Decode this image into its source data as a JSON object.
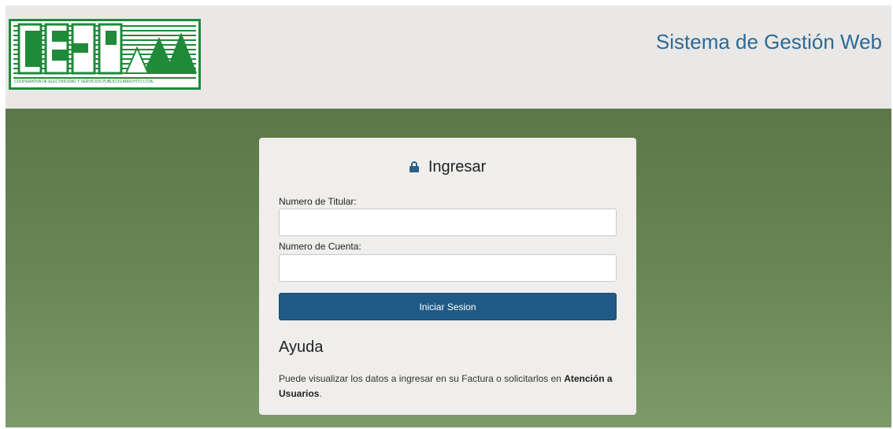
{
  "header": {
    "logo_text": "CESPAL",
    "logo_caption": "COOPERATIVA DE ELECTRICIDAD Y SERVICIOS PUBLICOS ARROYITO LTDA.",
    "app_title": "Sistema de Gestión Web"
  },
  "login": {
    "title": "Ingresar",
    "titular_label": "Numero de Titular:",
    "titular_value": "",
    "cuenta_label": "Numero de Cuenta:",
    "cuenta_value": "",
    "submit_label": "Iniciar Sesion"
  },
  "help": {
    "title": "Ayuda",
    "text": "Puede visualizar los datos a ingresar en su Factura o solicitarlos en",
    "link_label": "Atención a Usuarios",
    "suffix": "."
  },
  "colors": {
    "brand_green": "#1f8a3a",
    "title_blue": "#2d6a96",
    "button_blue": "#1e5a85",
    "background_green": "#647f4f"
  },
  "icons": {
    "lock": "lock-icon"
  }
}
